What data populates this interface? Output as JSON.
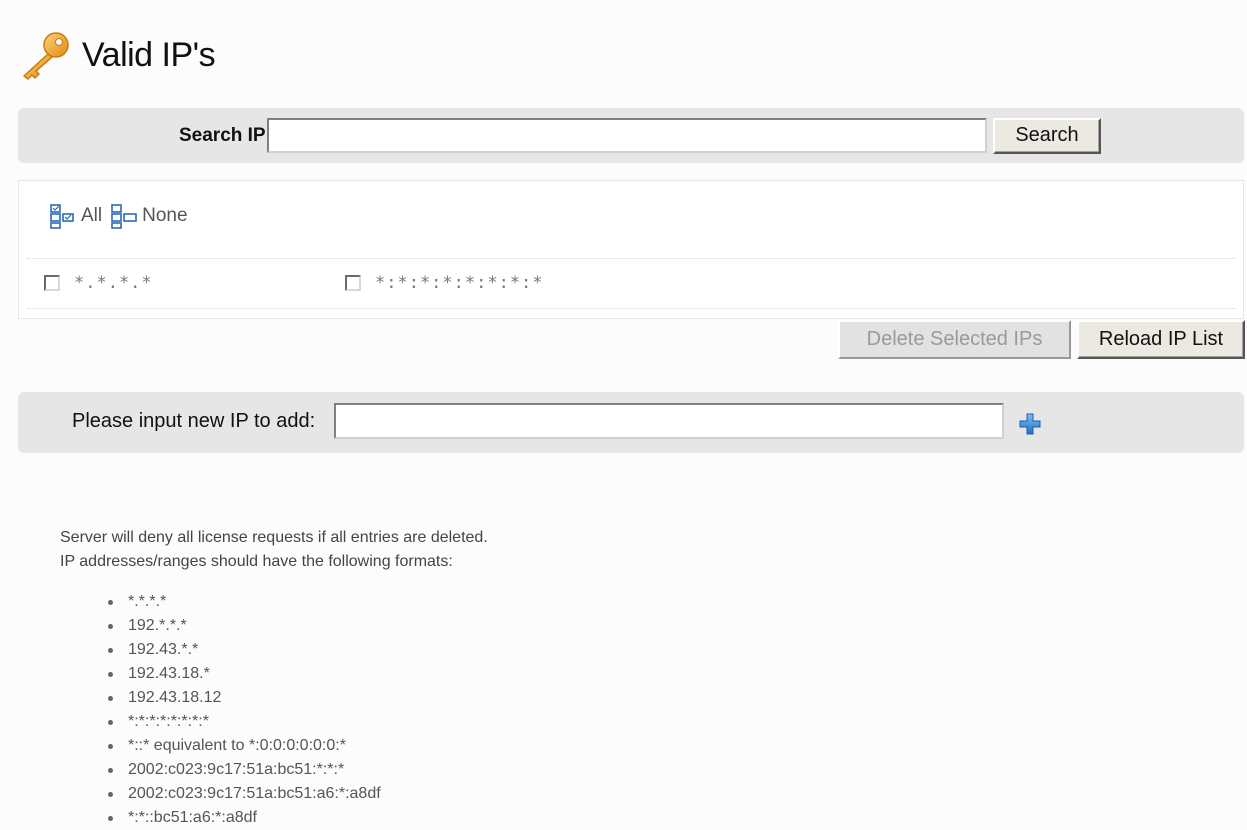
{
  "page": {
    "title": "Valid IP's",
    "icon": "key-icon",
    "accent_color": "#f0a030"
  },
  "search": {
    "label": "Search IP:",
    "value": "",
    "button_label": "Search"
  },
  "selection": {
    "all_label": "All",
    "none_label": "None",
    "all_icon": "select-all-icon",
    "none_icon": "select-none-icon"
  },
  "ip_list": [
    {
      "ip": "*.*.*.*",
      "checked": false
    },
    {
      "ip": "*:*:*:*:*:*:*:*",
      "checked": false
    }
  ],
  "actions": {
    "delete_label": "Delete Selected IPs",
    "delete_disabled": true,
    "reload_label": "Reload IP List"
  },
  "add_ip": {
    "label": "Please input new IP to add:",
    "value": "",
    "add_icon": "plus-icon",
    "add_icon_color": "#2a7fd4"
  },
  "info": {
    "line1": "Server will deny all license requests if all entries are deleted.",
    "line2": "IP addresses/ranges should have the following formats:",
    "formats": [
      "*.*.*.*",
      "192.*.*.*",
      "192.43.*.*",
      "192.43.18.*",
      "192.43.18.12",
      "*:*:*:*:*:*:*:*",
      "*::* equivalent to *:0:0:0:0:0:0:*",
      "2002:c023:9c17:51a:bc51:*:*:*",
      "2002:c023:9c17:51a:bc51:a6:*:a8df",
      "*:*::bc51:a6:*:a8df"
    ]
  }
}
